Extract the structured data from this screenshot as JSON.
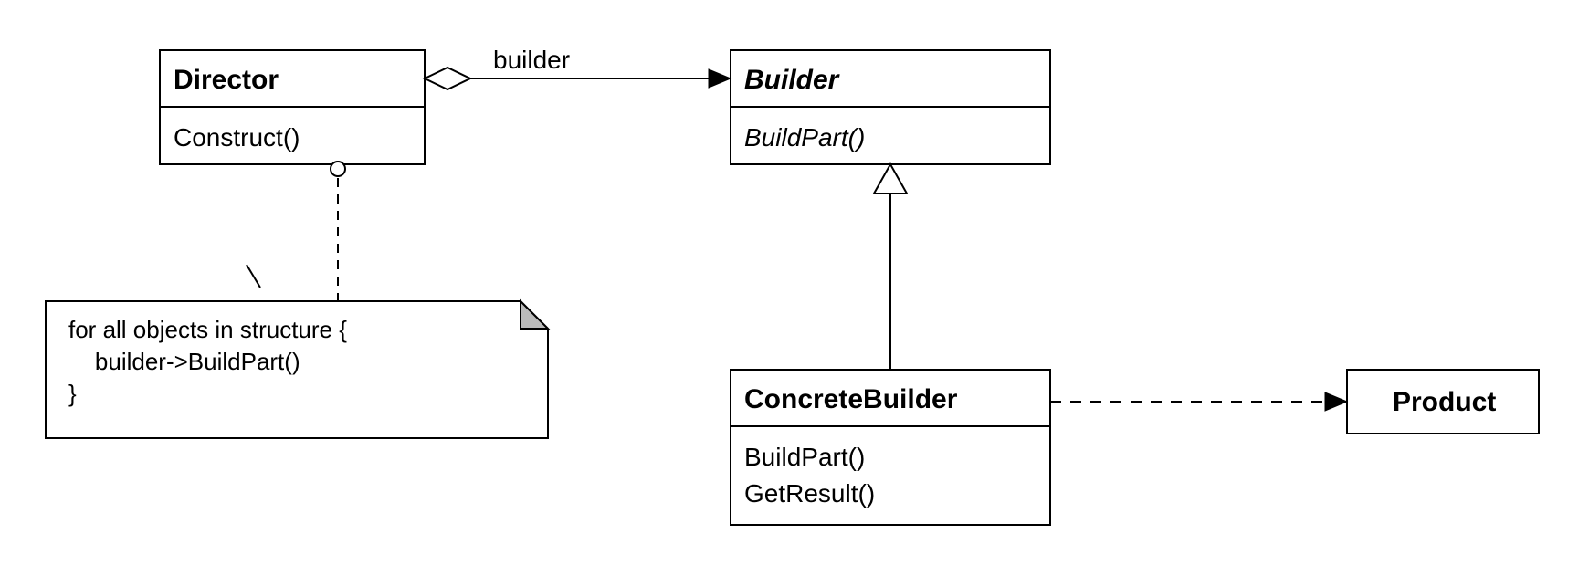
{
  "diagram": {
    "assoc_label": "builder",
    "classes": {
      "director": {
        "name": "Director",
        "methods": [
          "Construct()"
        ]
      },
      "builder": {
        "name": "Builder",
        "methods": [
          "BuildPart()"
        ],
        "abstract": true
      },
      "concrete": {
        "name": "ConcreteBuilder",
        "methods": [
          "BuildPart()",
          "GetResult()"
        ]
      },
      "product": {
        "name": "Product",
        "methods": []
      }
    },
    "note": {
      "line1": "for all objects in structure {",
      "line2": "    builder->BuildPart()",
      "line3": "}"
    }
  }
}
